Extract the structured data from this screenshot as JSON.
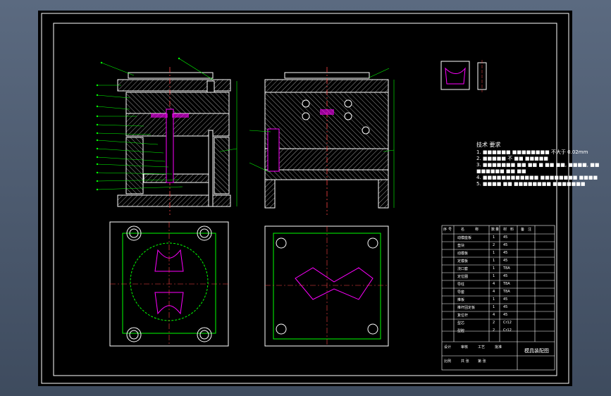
{
  "technical_requirements": {
    "title": "技术 要求",
    "lines": [
      "1. ■■■■■■ ■■■■■■■■ 不大于 0.02mm",
      "2. ■■■■■ 不 ■■ ■■■■■",
      "3. ■■■■■■■ ■■ ■■ ■ ■■ ■■, ■■■■, ■■",
      "   ■■■■■■ ■■ ■■",
      "4. ■■■■■■■■■■■■ ■■■■■■■■ ■■■■",
      "5. ■■■■ ■■ ■■■■■■■■ ■■■■■■■"
    ]
  },
  "title_block": {
    "header_cells": [
      "序",
      "号",
      "名",
      "称",
      "数",
      "量",
      "材",
      "料",
      "备",
      "注"
    ],
    "names": [
      "动模座板",
      "垫块",
      "动模板",
      "定模板",
      "浇口套",
      "定位圈",
      "导柱",
      "导套",
      "推板",
      "推杆固定板",
      "复位杆",
      "型芯",
      "型腔"
    ],
    "materials": [
      "45",
      "45",
      "45",
      "45",
      "T8A",
      "45",
      "T8A",
      "T8A",
      "45",
      "45",
      "45",
      "Cr12",
      "Cr12"
    ],
    "qty": [
      "1",
      "2",
      "1",
      "1",
      "1",
      "1",
      "4",
      "4",
      "1",
      "1",
      "4",
      "2",
      "2"
    ],
    "bottom_labels": [
      "设计",
      "审核",
      "工艺",
      "批准",
      "比例",
      "共 张",
      "第 张"
    ],
    "drawing_title": "模具装配图"
  },
  "colors": {
    "background": "#000000",
    "outline": "#ffffff",
    "section": "#00ff00",
    "hatch": "#aaaaaa",
    "centerline": "#ff4444",
    "highlight": "#ff00ff",
    "dimension": "#00ff00"
  }
}
